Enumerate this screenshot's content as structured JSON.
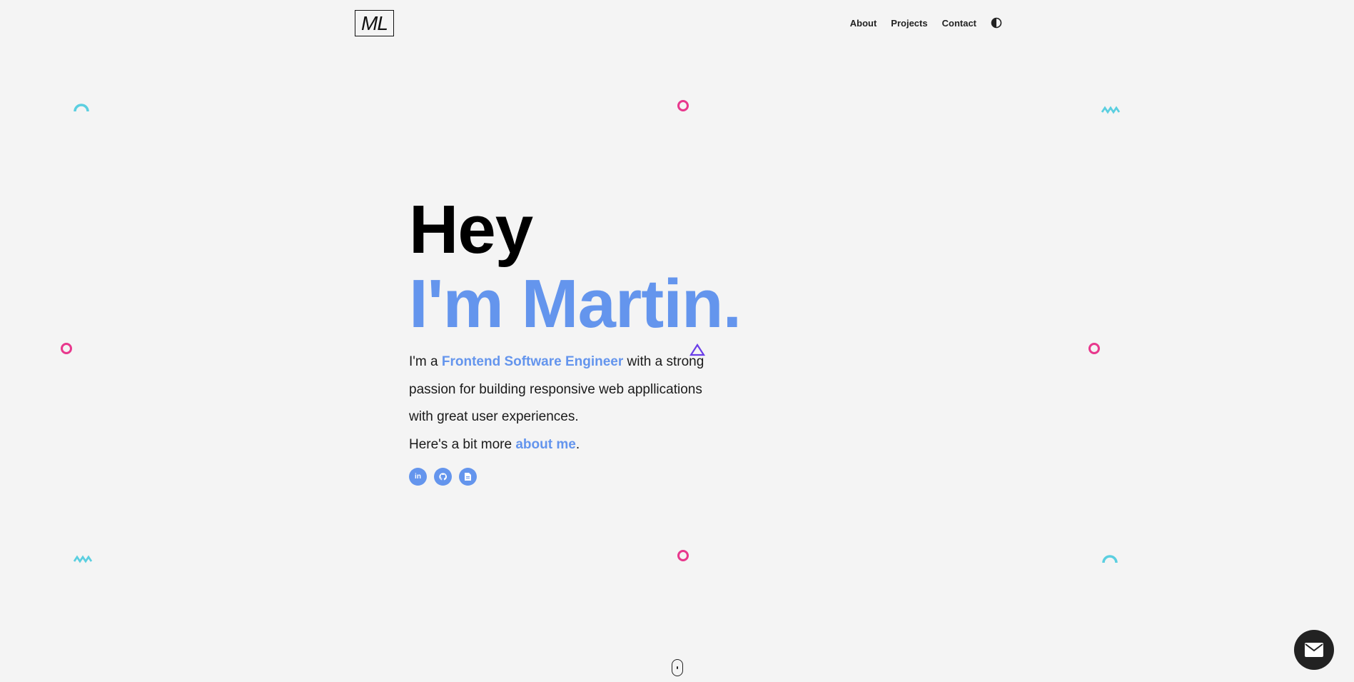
{
  "header": {
    "logo_text": "ML",
    "nav": [
      {
        "label": "About"
      },
      {
        "label": "Projects"
      },
      {
        "label": "Contact"
      }
    ],
    "theme_toggle_icon": "contrast-icon"
  },
  "hero": {
    "greeting": "Hey",
    "name_line": "I'm Martin.",
    "intro_prefix": "I'm a ",
    "role": "Frontend Software Engineer",
    "intro_rest": " with a strong passion for building responsive web appllications with great user experiences.",
    "more_prefix": "Here's a bit more ",
    "more_link": "about me",
    "more_suffix": ".",
    "socials": [
      {
        "icon": "linkedin-icon",
        "glyph": "in"
      },
      {
        "icon": "github-icon"
      },
      {
        "icon": "document-icon"
      }
    ]
  },
  "colors": {
    "accent": "#6495ed",
    "shape_pink": "#e8388d",
    "shape_cyan": "#5bcfe0",
    "shape_purple": "#6a3de8",
    "background": "#f4f4f4"
  },
  "fab_icon": "mail-icon"
}
